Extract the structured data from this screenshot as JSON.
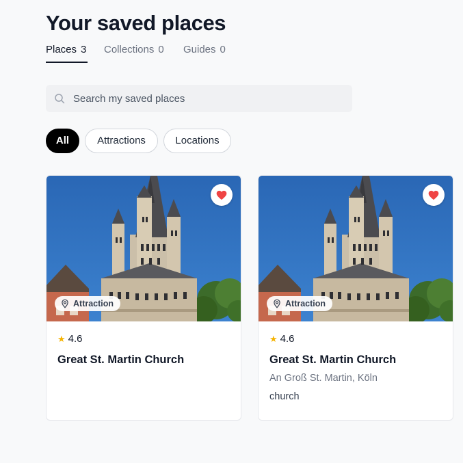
{
  "page": {
    "title": "Your saved places"
  },
  "tabs": [
    {
      "label": "Places",
      "count": "3",
      "active": true
    },
    {
      "label": "Collections",
      "count": "0",
      "active": false
    },
    {
      "label": "Guides",
      "count": "0",
      "active": false
    }
  ],
  "search": {
    "placeholder": "Search my saved places",
    "value": ""
  },
  "filters": [
    {
      "label": "All",
      "active": true
    },
    {
      "label": "Attractions",
      "active": false
    },
    {
      "label": "Locations",
      "active": false
    }
  ],
  "cards": [
    {
      "badge": "Attraction",
      "rating": "4.6",
      "name": "Great St. Martin Church",
      "address": "",
      "category": "",
      "saved": true
    },
    {
      "badge": "Attraction",
      "rating": "4.6",
      "name": "Great St. Martin Church",
      "address": "An Groß St. Martin, Köln",
      "category": "church",
      "saved": true
    }
  ],
  "colors": {
    "heart": "#ef4444",
    "star": "#f5b301",
    "active_chip": "#000000",
    "sky": "#2e6fbd"
  },
  "icons": {
    "search": "search-icon",
    "heart": "heart-icon",
    "badge": "location-pin-icon",
    "rating": "star-icon"
  }
}
